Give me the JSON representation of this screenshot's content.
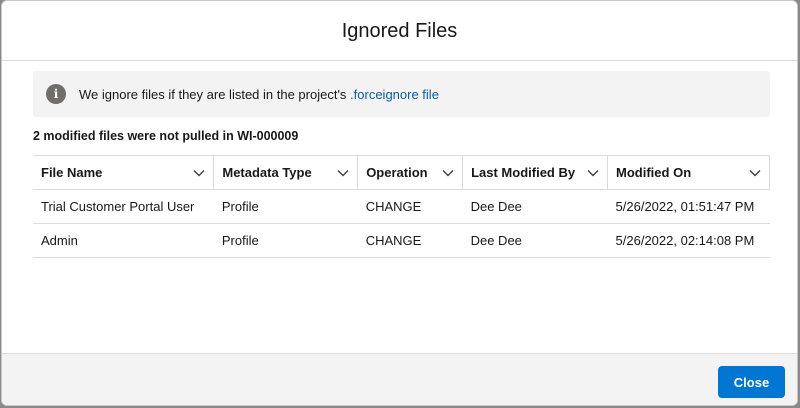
{
  "modal": {
    "title": "Ignored Files",
    "info": {
      "icon": "info-icon",
      "text": "We ignore files if they are listed in the project's ",
      "link_text": ".forceignore file"
    },
    "summary": "2 modified files were not pulled in WI-000009",
    "table": {
      "columns": [
        {
          "label": "File Name"
        },
        {
          "label": "Metadata Type"
        },
        {
          "label": "Operation"
        },
        {
          "label": "Last Modified By"
        },
        {
          "label": "Modified On"
        }
      ],
      "rows": [
        [
          "Trial Customer Portal User",
          "Profile",
          "CHANGE",
          "Dee Dee",
          "5/26/2022, 01:51:47 PM"
        ],
        [
          "Admin",
          "Profile",
          "CHANGE",
          "Dee Dee",
          "5/26/2022, 02:14:08 PM"
        ]
      ]
    },
    "footer": {
      "close_label": "Close"
    }
  },
  "colors": {
    "brand": "#0176d3",
    "link": "#0b5cab",
    "info_bg": "#f3f3f3",
    "border": "#dddbda"
  }
}
